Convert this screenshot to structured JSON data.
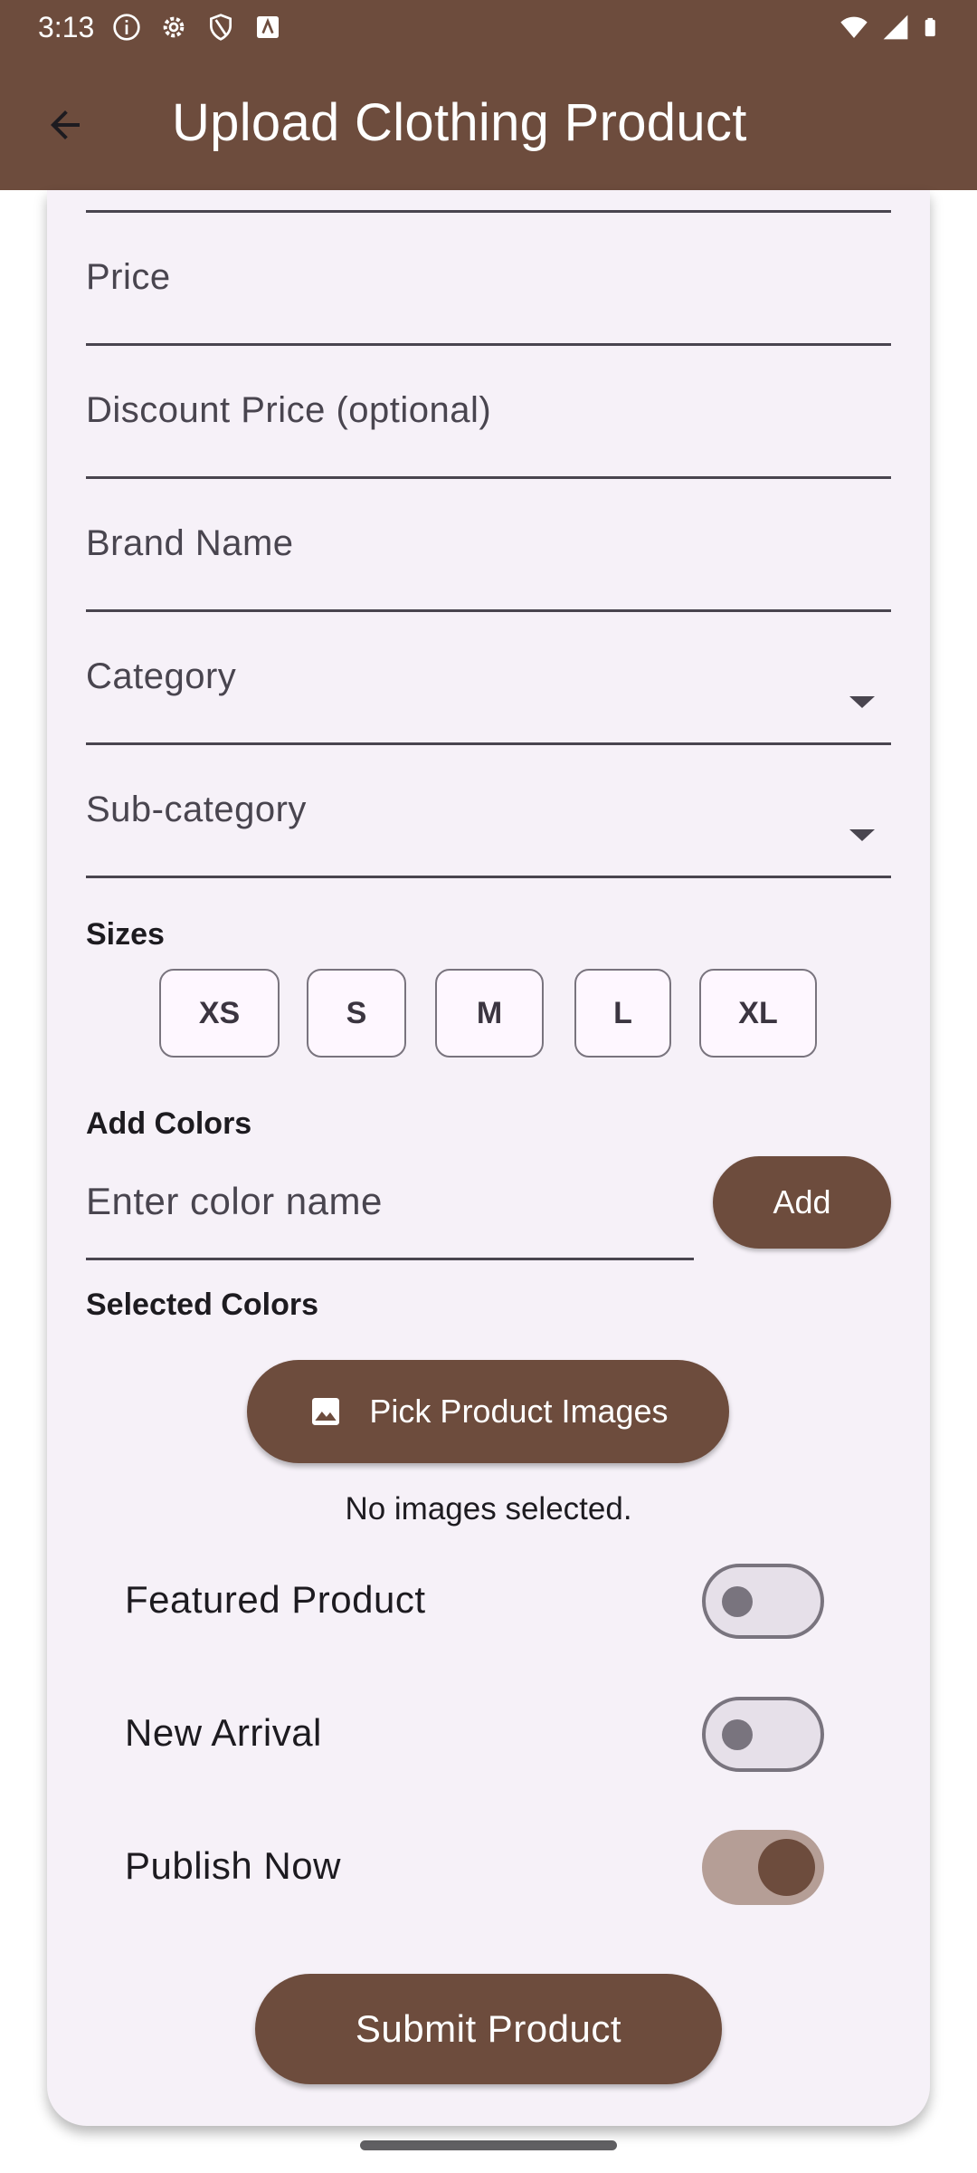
{
  "status_bar": {
    "time": "3:13",
    "left_icons": [
      "info-icon",
      "settings-icon",
      "shield-icon",
      "text-icon"
    ],
    "right_icons": [
      "wifi-icon",
      "signal-icon",
      "battery-icon"
    ]
  },
  "app_bar": {
    "title": "Upload Clothing Product",
    "back_icon": "arrow-back-icon"
  },
  "form": {
    "price_label": "Price",
    "discount_label": "Discount Price (optional)",
    "brand_label": "Brand Name",
    "category_label": "Category",
    "subcategory_label": "Sub-category"
  },
  "sizes": {
    "title": "Sizes",
    "options": [
      "XS",
      "S",
      "M",
      "L",
      "XL"
    ]
  },
  "colors": {
    "title": "Add Colors",
    "input_placeholder": "Enter color name",
    "add_label": "Add",
    "selected_title": "Selected Colors"
  },
  "images": {
    "pick_label": "Pick Product Images",
    "pick_icon": "image-icon",
    "empty_text": "No images selected."
  },
  "toggles": [
    {
      "label": "Featured Product",
      "on": false
    },
    {
      "label": "New Arrival",
      "on": false
    },
    {
      "label": "Publish Now",
      "on": true
    }
  ],
  "submit_label": "Submit Product",
  "colors_theme": {
    "primary": "#6d4c3d",
    "surface": "#f6f1f8",
    "switch_on_track": "#b59e96"
  }
}
